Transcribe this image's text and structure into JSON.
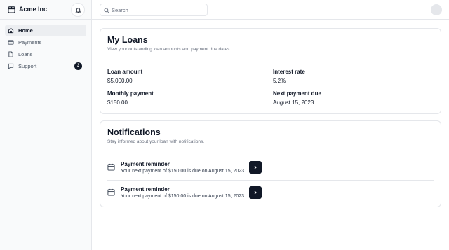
{
  "brand": {
    "name": "Acme Inc",
    "icon": "package-icon"
  },
  "sidebar": {
    "items": [
      {
        "label": "Home",
        "icon": "home-icon",
        "active": true
      },
      {
        "label": "Payments",
        "icon": "credit-card-icon",
        "active": false
      },
      {
        "label": "Loans",
        "icon": "file-icon",
        "active": false
      },
      {
        "label": "Support",
        "icon": "message-icon",
        "active": false,
        "badge": "3"
      }
    ]
  },
  "search": {
    "placeholder": "Search",
    "value": ""
  },
  "loans": {
    "title": "My Loans",
    "subtitle": "View your outstanding loan amounts and payment due dates.",
    "fields": [
      {
        "label": "Loan amount",
        "value": "$5,000.00"
      },
      {
        "label": "Interest rate",
        "value": "5.2%"
      },
      {
        "label": "Monthly payment",
        "value": "$150.00"
      },
      {
        "label": "Next payment due",
        "value": "August 15, 2023"
      }
    ]
  },
  "notifications": {
    "title": "Notifications",
    "subtitle": "Stay informed about your loan with notifications.",
    "items": [
      {
        "title": "Payment reminder",
        "text": "Your next payment of $150.00 is due on August 15, 2023."
      },
      {
        "title": "Payment reminder",
        "text": "Your next payment of $150.00 is due on August 15, 2023."
      }
    ]
  },
  "colors": {
    "accent": "#111827",
    "muted": "#6b7280",
    "border": "#e5e7eb",
    "sidebar_bg": "#f9fafb"
  }
}
